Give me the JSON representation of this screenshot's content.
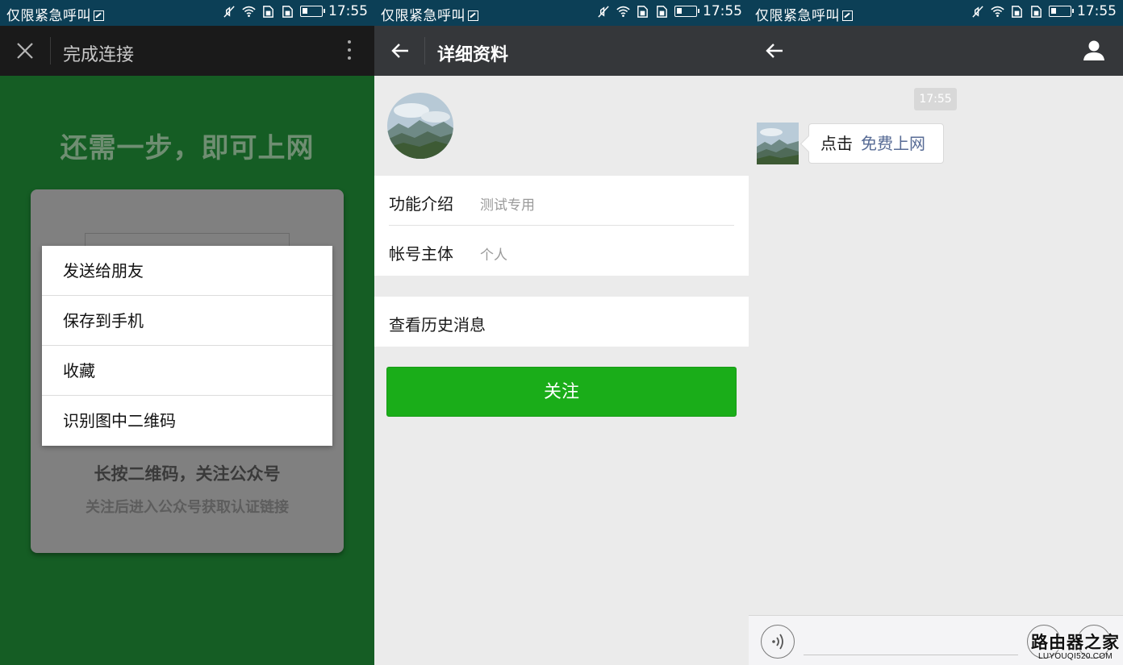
{
  "status_bar": {
    "carrier": "仅限紧急呼叫",
    "time": "17:55"
  },
  "panel1": {
    "title": "完成连接",
    "headline": "还需一步，即可上网",
    "menu": [
      "发送给朋友",
      "保存到手机",
      "收藏",
      "识别图中二维码"
    ],
    "caption_main": "长按二维码，关注公众号",
    "caption_sub": "关注后进入公众号获取认证链接",
    "colors": {
      "page_bg": "#155d24",
      "card": "#808080"
    }
  },
  "panel2": {
    "title": "详细资料",
    "rows": [
      {
        "label": "功能介绍",
        "value": "测试专用"
      },
      {
        "label": "帐号主体",
        "value": "个人"
      }
    ],
    "history_label": "查看历史消息",
    "follow_label": "关注",
    "colors": {
      "follow": "#1aad19"
    }
  },
  "panel3": {
    "timestamp": "17:55",
    "message_prefix": "点击",
    "message_link": "免费上网",
    "colors": {
      "link": "#576b95"
    }
  },
  "watermark": {
    "main": "路由器之家",
    "sub": "LUYOUQI520.COM"
  },
  "icons": [
    "close-icon",
    "more-icon",
    "back-arrow-icon",
    "user-icon",
    "voice-icon",
    "wifi-icon",
    "battery-icon",
    "sim-icon",
    "mute-icon"
  ]
}
